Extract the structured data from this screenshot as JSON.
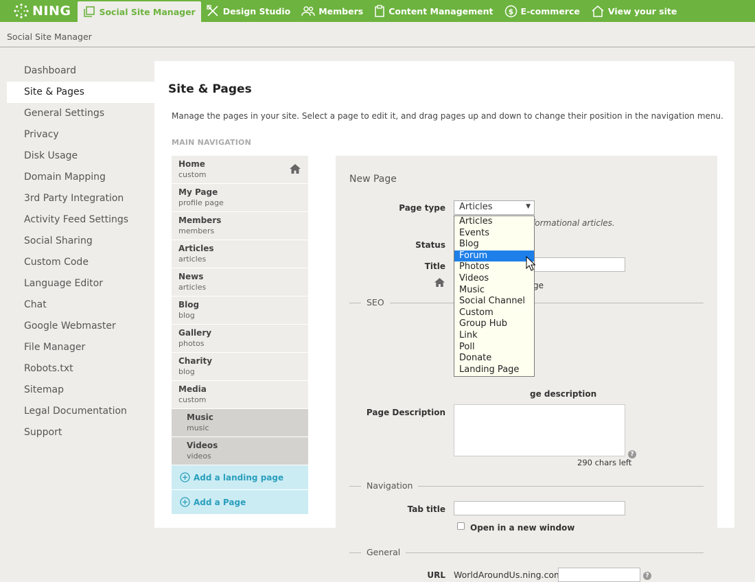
{
  "topnav": {
    "logo": "NING",
    "items": [
      {
        "label": "Social Site Manager",
        "active": true
      },
      {
        "label": "Design Studio"
      },
      {
        "label": "Members"
      },
      {
        "label": "Content Management"
      },
      {
        "label": "E-commerce"
      },
      {
        "label": "View your site"
      }
    ]
  },
  "breadcrumb": "Social Site Manager",
  "sidebar": {
    "items": [
      {
        "label": "Dashboard"
      },
      {
        "label": "Site & Pages",
        "active": true
      },
      {
        "label": "General Settings"
      },
      {
        "label": "Privacy"
      },
      {
        "label": "Disk Usage"
      },
      {
        "label": "Domain Mapping"
      },
      {
        "label": "3rd Party Integration"
      },
      {
        "label": "Activity Feed Settings"
      },
      {
        "label": "Social Sharing"
      },
      {
        "label": "Custom Code"
      },
      {
        "label": "Language Editor"
      },
      {
        "label": "Chat"
      },
      {
        "label": "Google Webmaster"
      },
      {
        "label": "File Manager"
      },
      {
        "label": "Robots.txt"
      },
      {
        "label": "Sitemap"
      },
      {
        "label": "Legal Documentation"
      },
      {
        "label": "Support"
      }
    ]
  },
  "main": {
    "title": "Site & Pages",
    "description": "Manage the pages in your site. Select a page to edit it, and drag pages up and down to change their position in the navigation menu.",
    "nav_label": "MAIN NAVIGATION",
    "pages": [
      {
        "name": "Home",
        "type": "custom",
        "home": true
      },
      {
        "name": "My Page",
        "type": "profile page"
      },
      {
        "name": "Members",
        "type": "members"
      },
      {
        "name": "Articles",
        "type": "articles"
      },
      {
        "name": "News",
        "type": "articles"
      },
      {
        "name": "Blog",
        "type": "blog"
      },
      {
        "name": "Gallery",
        "type": "photos"
      },
      {
        "name": "Charity",
        "type": "blog"
      },
      {
        "name": "Media",
        "type": "custom"
      },
      {
        "name": "Music",
        "type": "music",
        "sub": true
      },
      {
        "name": "Videos",
        "type": "videos",
        "sub": true
      }
    ],
    "add_landing": "Add a landing page",
    "add_page": "Add a Page"
  },
  "form": {
    "heading": "New Page",
    "page_type_label": "Page type",
    "page_type_value": "Articles",
    "page_type_hint": "formational articles.",
    "status_label": "Status",
    "title_label": "Title",
    "home_hint": "ge",
    "seo_section": "SEO",
    "seo_hint": "ge description",
    "page_desc_label": "Page Description",
    "chars_left": "290 chars left",
    "nav_section": "Navigation",
    "tab_title_label": "Tab title",
    "open_new_window": "Open in a new window",
    "general_section": "General",
    "url_label": "URL",
    "url_prefix": "WorldAroundUs.ning.com/"
  },
  "dropdown": {
    "options": [
      "Articles",
      "Events",
      "Blog",
      "Forum",
      "Photos",
      "Videos",
      "Music",
      "Social Channel",
      "Custom",
      "Group Hub",
      "Link",
      "Poll",
      "Donate",
      "Landing Page"
    ],
    "highlighted": "Forum"
  },
  "colors": {
    "brand_green": "#6db33f",
    "highlight_blue": "#1e7fe8",
    "add_bg": "#ccecf4",
    "add_text": "#2a9fbc"
  }
}
